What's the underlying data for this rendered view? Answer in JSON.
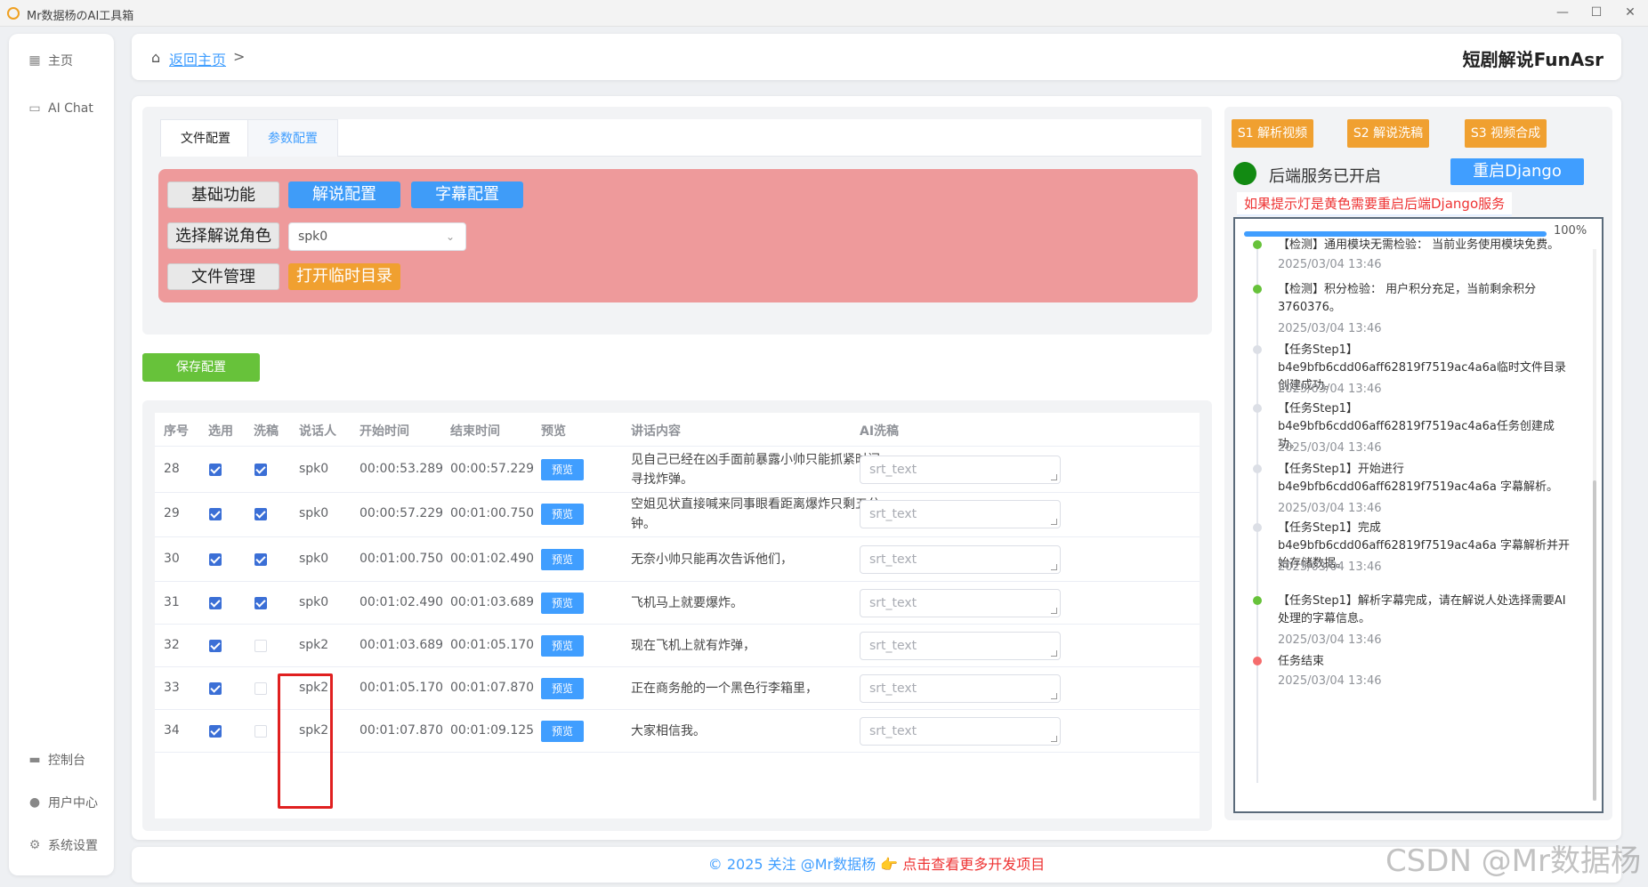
{
  "window": {
    "title": "Mr数据杨のAI工具箱"
  },
  "sidebar": {
    "top": [
      {
        "label": "主页",
        "icon": "grid-icon"
      },
      {
        "label": "AI Chat",
        "icon": "chat-icon"
      }
    ],
    "bottom": [
      {
        "label": "控制台",
        "icon": "monitor-icon"
      },
      {
        "label": "用户中心",
        "icon": "user-icon"
      },
      {
        "label": "系统设置",
        "icon": "gear-icon"
      }
    ]
  },
  "header": {
    "back_link": "返回主页",
    "separator": ">",
    "app_title": "短剧解说FunAsr"
  },
  "config": {
    "tabs": [
      "文件配置",
      "参数配置"
    ],
    "buttons": {
      "basic": "基础功能",
      "narration": "解说配置",
      "subtitle": "字幕配置",
      "choose_role": "选择解说角色",
      "file_manage": "文件管理",
      "open_temp": "打开临时目录"
    },
    "role_select_value": "spk0",
    "save_button": "保存配置"
  },
  "table": {
    "headers": [
      "序号",
      "选用",
      "洗稿",
      "说话人",
      "开始时间",
      "结束时间",
      "预览",
      "讲话内容",
      "AI洗稿"
    ],
    "preview_label": "预览",
    "ai_placeholder": "srt_text",
    "rows": [
      {
        "idx": "28",
        "use": true,
        "wash": true,
        "speaker": "spk0",
        "start": "00:00:53.289",
        "end": "00:00:57.229",
        "content": "见自己已经在凶手面前暴露小帅只能抓紧时间寻找炸弹。"
      },
      {
        "idx": "29",
        "use": true,
        "wash": true,
        "speaker": "spk0",
        "start": "00:00:57.229",
        "end": "00:01:00.750",
        "content": "空姐见状直接喊来同事眼看距离爆炸只剩五分钟。"
      },
      {
        "idx": "30",
        "use": true,
        "wash": true,
        "speaker": "spk0",
        "start": "00:01:00.750",
        "end": "00:01:02.490",
        "content": "无奈小帅只能再次告诉他们，"
      },
      {
        "idx": "31",
        "use": true,
        "wash": true,
        "speaker": "spk0",
        "start": "00:01:02.490",
        "end": "00:01:03.689",
        "content": "飞机马上就要爆炸。"
      },
      {
        "idx": "32",
        "use": true,
        "wash": false,
        "speaker": "spk2",
        "start": "00:01:03.689",
        "end": "00:01:05.170",
        "content": "现在飞机上就有炸弹，"
      },
      {
        "idx": "33",
        "use": true,
        "wash": false,
        "speaker": "spk2",
        "start": "00:01:05.170",
        "end": "00:01:07.870",
        "content": "正在商务舱的一个黑色行李箱里，"
      },
      {
        "idx": "34",
        "use": true,
        "wash": false,
        "speaker": "spk2",
        "start": "00:01:07.870",
        "end": "00:01:09.125",
        "content": "大家相信我。"
      }
    ]
  },
  "right": {
    "steps": [
      "S1 解析视频",
      "S2 解说洗稿",
      "S3 视频合成"
    ],
    "status_text": "后端服务已开启",
    "restart_button": "重启Django",
    "warning": "如果提示灯是黄色需要重启后端Django服务",
    "progress_pct": "100%",
    "progress_value": 100,
    "logs": [
      {
        "text": "【检测】通用模块无需检验： 当前业务使用模块免费。",
        "time": "2025/03/04 13:46",
        "color": "#67c23a"
      },
      {
        "text": "【检测】积分检验： 用户积分充足，当前剩余积分3760376。",
        "time": "2025/03/04 13:46",
        "color": "#67c23a"
      },
      {
        "text": "【任务Step1】 b4e9bfb6cdd06aff62819f7519ac4a6a临时文件目录创建成功。",
        "time": "2025/03/04 13:46",
        "color": "#dcdfe6"
      },
      {
        "text": "【任务Step1】 b4e9bfb6cdd06aff62819f7519ac4a6a任务创建成功。",
        "time": "2025/03/04 13:46",
        "color": "#dcdfe6"
      },
      {
        "text": "【任务Step1】开始进行b4e9bfb6cdd06aff62819f7519ac4a6a 字幕解析。",
        "time": "2025/03/04 13:46",
        "color": "#dcdfe6"
      },
      {
        "text": "【任务Step1】完成b4e9bfb6cdd06aff62819f7519ac4a6a 字幕解析并开始存储数据。",
        "time": "2025/03/04 13:46",
        "color": "#dcdfe6"
      },
      {
        "text": "【任务Step1】解析字幕完成，请在解说人处选择需要AI处理的字幕信息。",
        "time": "2025/03/04 13:46",
        "color": "#67c23a"
      },
      {
        "text": "任务结束",
        "time": "2025/03/04 13:46",
        "color": "#f56c6c"
      }
    ]
  },
  "footer": {
    "copyright": "© 2025 关注 @Mr数据杨",
    "emoji": "👉",
    "link": "点击查看更多开发项目"
  },
  "watermark": "CSDN @Mr数据杨"
}
